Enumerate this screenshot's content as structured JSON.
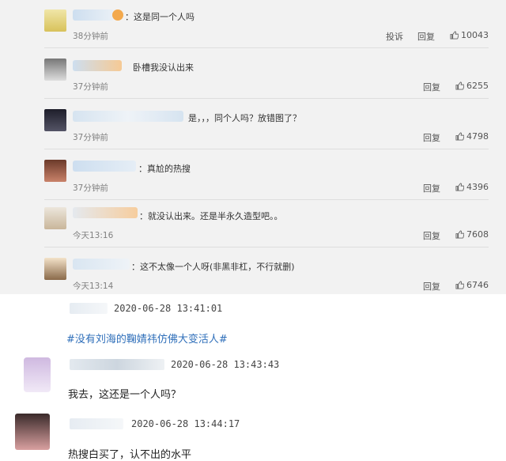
{
  "comments": [
    {
      "text": "：这是同一个人吗",
      "time": "38分钟前",
      "report": "投诉",
      "reply": "回复",
      "likes": "10043"
    },
    {
      "text": "卧槽我没认出来",
      "time": "37分钟前",
      "reply": "回复",
      "likes": "6255"
    },
    {
      "text": "是，，，同个人吗？放错图了？",
      "time": "37分钟前",
      "reply": "回复",
      "likes": "4798"
    },
    {
      "text": "：真尬的热搜",
      "time": "37分钟前",
      "reply": "回复",
      "likes": "4396"
    },
    {
      "text": "：就没认出来。还是半永久造型吧。。",
      "time": "今天13:16",
      "reply": "回复",
      "likes": "7608"
    },
    {
      "text": "：这不太像一个人呀(非黑非杠，不行就删)",
      "time": "今天13:14",
      "reply": "回复",
      "likes": "6746"
    }
  ],
  "bottom": {
    "post1": {
      "time": "2020-06-28 13:41:01",
      "tag": "#没有刘海的鞠婧祎仿佛大变活人#"
    },
    "post2": {
      "time": "2020-06-28 13:43:43",
      "text": "我去，这还是一个人吗？"
    },
    "post3": {
      "time": "2020-06-28 13:44:17",
      "text": "热搜白买了，认不出的水平"
    }
  }
}
